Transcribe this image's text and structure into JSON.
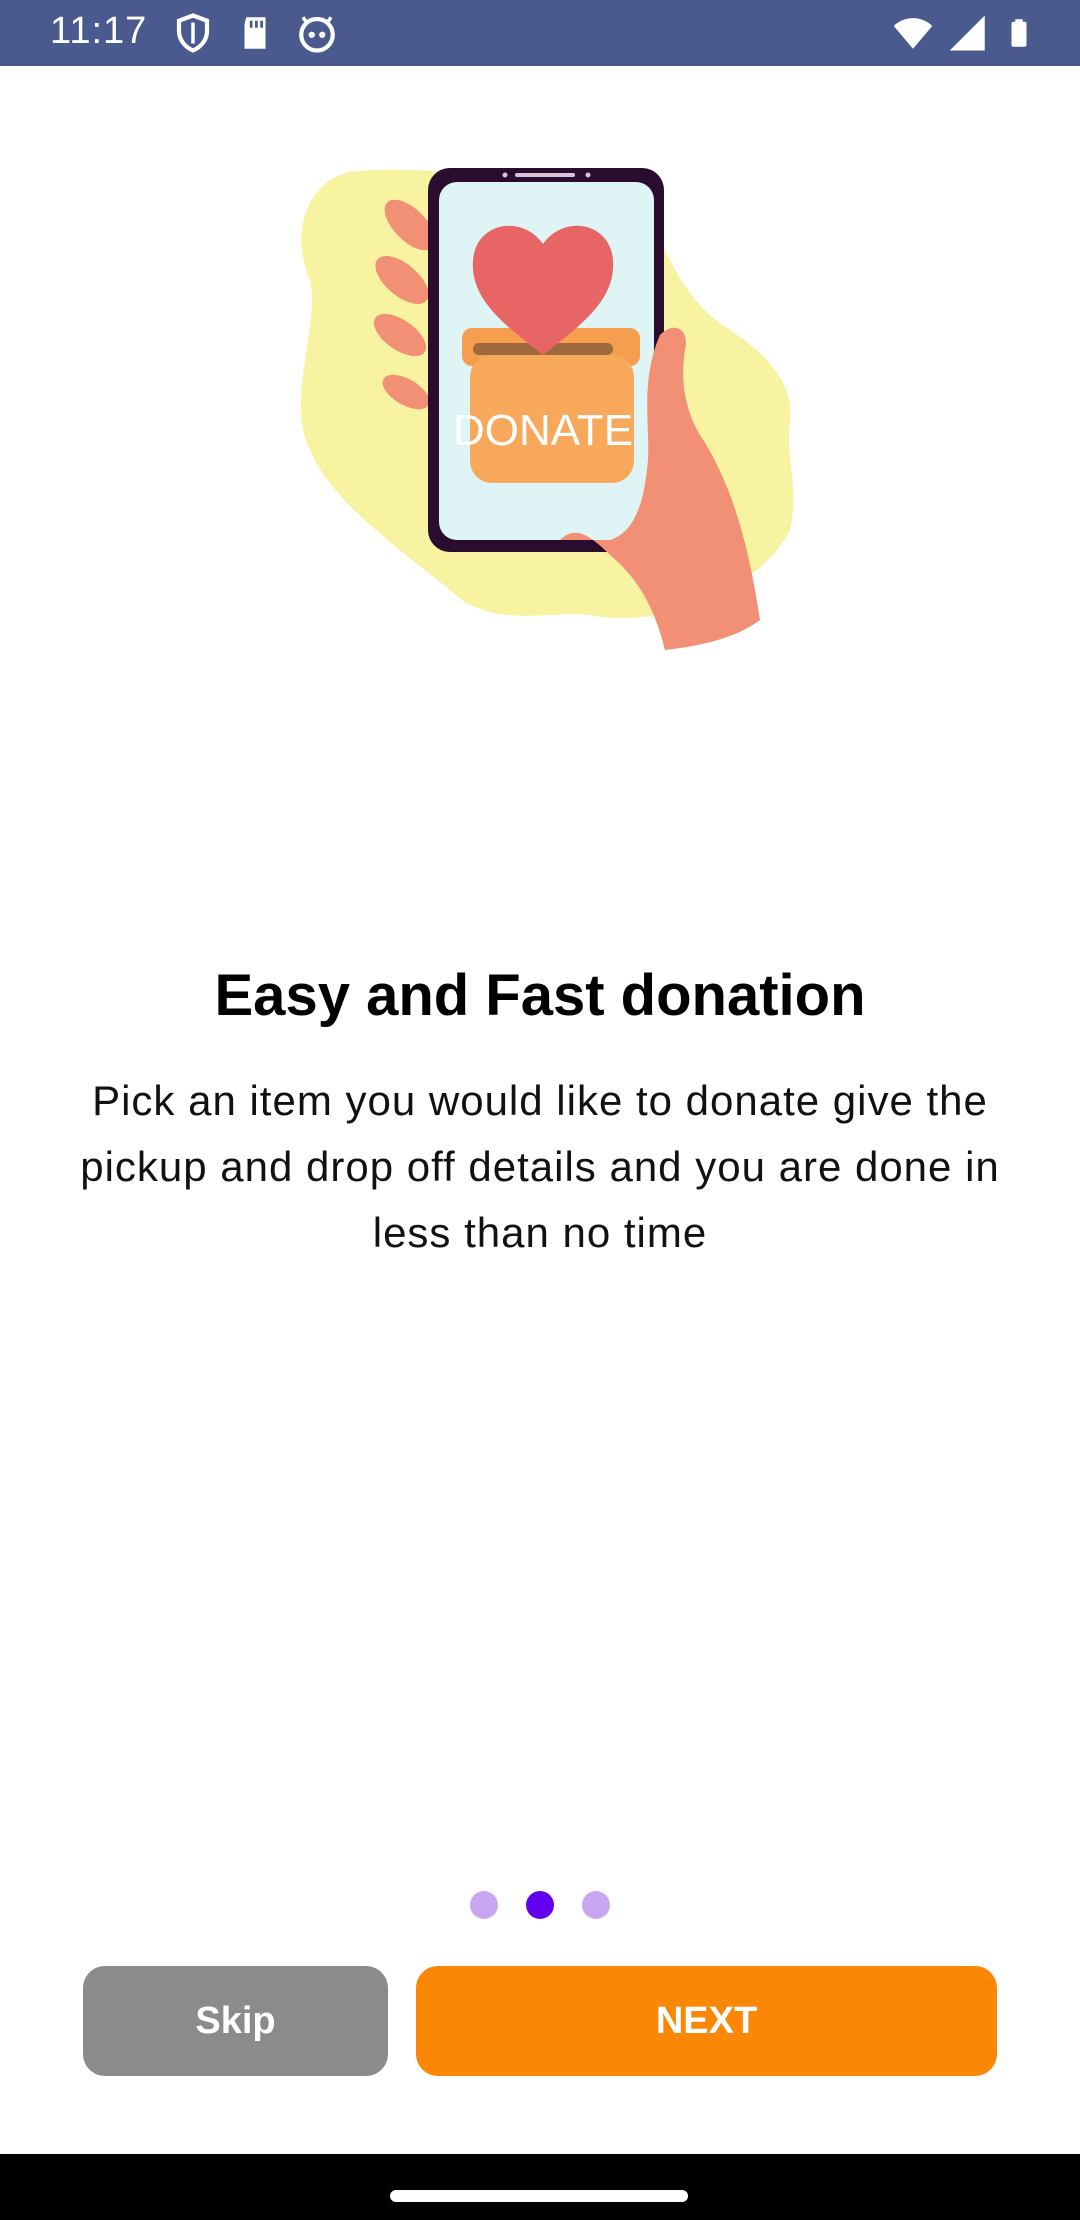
{
  "status_bar": {
    "time": "11:17",
    "left_icons": [
      "shield-icon",
      "sd-card-icon",
      "robot-face-icon"
    ],
    "right_icons": [
      "wifi-icon",
      "signal-icon",
      "battery-icon"
    ]
  },
  "illustration": {
    "label": "DONATE",
    "icon": "donate-phone-illustration"
  },
  "onboarding": {
    "title": "Easy and Fast donation",
    "description": "Pick an item you would like to donate give the pickup and drop off details and you are done in less than no time"
  },
  "pager": {
    "page_count": 3,
    "active_index": 1
  },
  "buttons": {
    "skip_label": "Skip",
    "next_label": "NEXT"
  },
  "colors": {
    "status_bar": "#4a5a8f",
    "skip": "#8b8b8b",
    "next": "#fa8705",
    "dot_active": "#6200ee",
    "dot_inactive": "#c8a6f2"
  }
}
